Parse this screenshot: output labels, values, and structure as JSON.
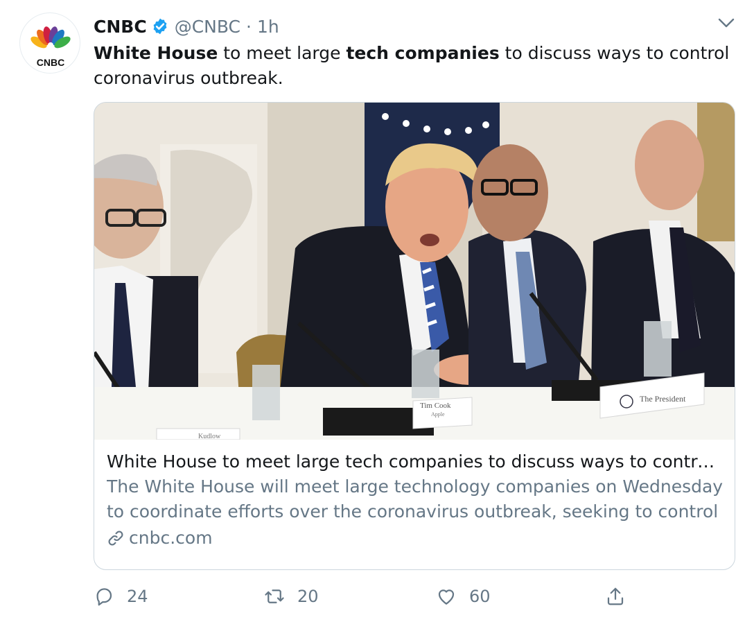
{
  "tweet": {
    "author_name": "CNBC",
    "author_handle": "@CNBC",
    "separator": "·",
    "time": "1h",
    "avatar_logo_text": "CNBC",
    "text_parts": {
      "part1_bold": "White House",
      "part2": " to meet large ",
      "part3_bold": "tech companies",
      "part4": " to discuss ways to control coronavirus outbreak."
    }
  },
  "card": {
    "image_placards": [
      "Tim Cook",
      "Apple",
      "The President",
      "Kudlow"
    ],
    "title": "White House to meet large tech companies to discuss ways to control coronavirus outbreak",
    "description": "The White House will meet large technology companies on Wednesday to coordinate efforts over the coronavirus outbreak, seeking to control a",
    "domain": "cnbc.com"
  },
  "actions": {
    "reply_count": "24",
    "retweet_count": "20",
    "like_count": "60"
  },
  "icons": {
    "verified": "verified-badge-icon",
    "caret": "chevron-down-icon",
    "link": "link-icon",
    "reply": "reply-icon",
    "retweet": "retweet-icon",
    "like": "heart-icon",
    "share": "share-icon"
  },
  "colors": {
    "text_primary": "#14171a",
    "text_secondary": "#657786",
    "verified_blue": "#1da1f2",
    "border": "#ccd6dd"
  }
}
